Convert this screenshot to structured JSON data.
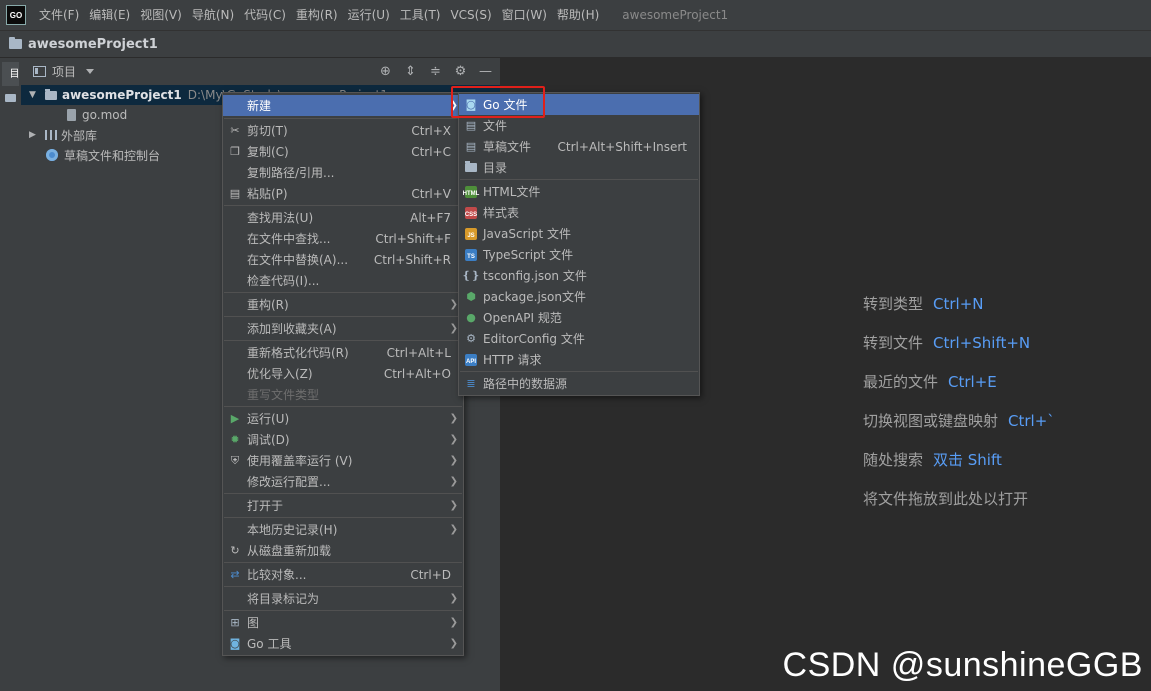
{
  "menubar": {
    "logo": "GO",
    "items": [
      "文件(F)",
      "编辑(E)",
      "视图(V)",
      "导航(N)",
      "代码(C)",
      "重构(R)",
      "运行(U)",
      "工具(T)",
      "VCS(S)",
      "窗口(W)",
      "帮助(H)"
    ],
    "window_title": "awesomeProject1"
  },
  "navbar": {
    "title": "awesomeProject1"
  },
  "toolstrip": {
    "tab_label": "项目"
  },
  "project_panel": {
    "title": "项目",
    "tree": [
      {
        "label": "awesomeProject1",
        "path": "D:\\My\\GoStudy\\awesomeProject1"
      },
      {
        "label": "go.mod"
      },
      {
        "label": "外部库"
      },
      {
        "label": "草稿文件和控制台"
      }
    ]
  },
  "context_menu": {
    "items": [
      {
        "label": "新建",
        "shortcut": "",
        "submenu": true,
        "icon": "none"
      },
      {
        "label": "剪切(T)",
        "shortcut": "Ctrl+X",
        "icon": "scissors-icon"
      },
      {
        "label": "复制(C)",
        "shortcut": "Ctrl+C",
        "icon": "copy-icon"
      },
      {
        "label": "复制路径/引用...",
        "shortcut": "",
        "icon": "none"
      },
      {
        "label": "粘贴(P)",
        "shortcut": "Ctrl+V",
        "icon": "paste-icon"
      },
      {
        "label": "查找用法(U)",
        "shortcut": "Alt+F7",
        "icon": "none"
      },
      {
        "label": "在文件中查找...",
        "shortcut": "Ctrl+Shift+F",
        "icon": "none"
      },
      {
        "label": "在文件中替换(A)...",
        "shortcut": "Ctrl+Shift+R",
        "icon": "none"
      },
      {
        "label": "检查代码(I)...",
        "shortcut": "",
        "icon": "none"
      },
      {
        "label": "重构(R)",
        "shortcut": "",
        "submenu": true,
        "icon": "none"
      },
      {
        "label": "添加到收藏夹(A)",
        "shortcut": "",
        "submenu": true,
        "icon": "none"
      },
      {
        "label": "重新格式化代码(R)",
        "shortcut": "Ctrl+Alt+L",
        "icon": "none"
      },
      {
        "label": "优化导入(Z)",
        "shortcut": "Ctrl+Alt+O",
        "icon": "none"
      },
      {
        "label": "重写文件类型",
        "shortcut": "",
        "icon": "none",
        "disabled": true
      },
      {
        "label": "运行(U)",
        "shortcut": "",
        "submenu": true,
        "icon": "run-icon"
      },
      {
        "label": "调试(D)",
        "shortcut": "",
        "submenu": true,
        "icon": "debug-icon"
      },
      {
        "label": "使用覆盖率运行 (V)",
        "shortcut": "",
        "submenu": true,
        "icon": "coverage-icon"
      },
      {
        "label": "修改运行配置...",
        "shortcut": "",
        "submenu": true,
        "icon": "none"
      },
      {
        "label": "打开于",
        "shortcut": "",
        "submenu": true,
        "icon": "none"
      },
      {
        "label": "本地历史记录(H)",
        "shortcut": "",
        "submenu": true,
        "icon": "none"
      },
      {
        "label": "从磁盘重新加载",
        "shortcut": "",
        "icon": "reload-icon"
      },
      {
        "label": "比较对象...",
        "shortcut": "Ctrl+D",
        "icon": "compare-icon"
      },
      {
        "label": "将目录标记为",
        "shortcut": "",
        "submenu": true,
        "icon": "none"
      },
      {
        "label": "图",
        "shortcut": "",
        "submenu": true,
        "icon": "diagram-icon"
      },
      {
        "label": "Go 工具",
        "shortcut": "",
        "submenu": true,
        "icon": "go-tool-icon"
      }
    ]
  },
  "new_submenu": {
    "items": [
      {
        "label": "Go 文件",
        "shortcut": "",
        "icon": "go-file-icon"
      },
      {
        "label": "文件",
        "shortcut": "",
        "icon": "file-icon"
      },
      {
        "label": "草稿文件",
        "shortcut": "Ctrl+Alt+Shift+Insert",
        "icon": "scratch-file-icon"
      },
      {
        "label": "目录",
        "shortcut": "",
        "icon": "directory-icon"
      },
      {
        "label": "HTML文件",
        "shortcut": "",
        "icon": "html-file-icon",
        "badge": "HTML"
      },
      {
        "label": "样式表",
        "shortcut": "",
        "icon": "stylesheet-icon",
        "badge": "CSS"
      },
      {
        "label": "JavaScript 文件",
        "shortcut": "",
        "icon": "javascript-file-icon",
        "badge": "JS"
      },
      {
        "label": "TypeScript 文件",
        "shortcut": "",
        "icon": "typescript-file-icon",
        "badge": "TS"
      },
      {
        "label": "tsconfig.json 文件",
        "shortcut": "",
        "icon": "tsconfig-icon"
      },
      {
        "label": "package.json文件",
        "shortcut": "",
        "icon": "package-json-icon"
      },
      {
        "label": "OpenAPI 规范",
        "shortcut": "",
        "icon": "openapi-icon"
      },
      {
        "label": "EditorConfig 文件",
        "shortcut": "",
        "icon": "editorconfig-icon"
      },
      {
        "label": "HTTP 请求",
        "shortcut": "",
        "icon": "http-request-icon",
        "badge": "API"
      },
      {
        "label": "路径中的数据源",
        "shortcut": "",
        "icon": "datasource-icon"
      }
    ]
  },
  "editor_hints": [
    {
      "text": "转到类型",
      "key": "Ctrl+N"
    },
    {
      "text": "转到文件",
      "key": "Ctrl+Shift+N"
    },
    {
      "text": "最近的文件",
      "key": "Ctrl+E"
    },
    {
      "text": "切换视图或键盘映射",
      "key": "Ctrl+`"
    },
    {
      "text": "随处搜索",
      "key": "双击 Shift"
    },
    {
      "text": "将文件拖放到此处以打开",
      "key": ""
    }
  ],
  "watermark": "CSDN @sunshineGGB",
  "colors": {
    "menu_bg": "#3c3f41",
    "highlight": "#4b6eaf",
    "key_blue": "#589df6",
    "annotation_red": "#e0201a"
  }
}
